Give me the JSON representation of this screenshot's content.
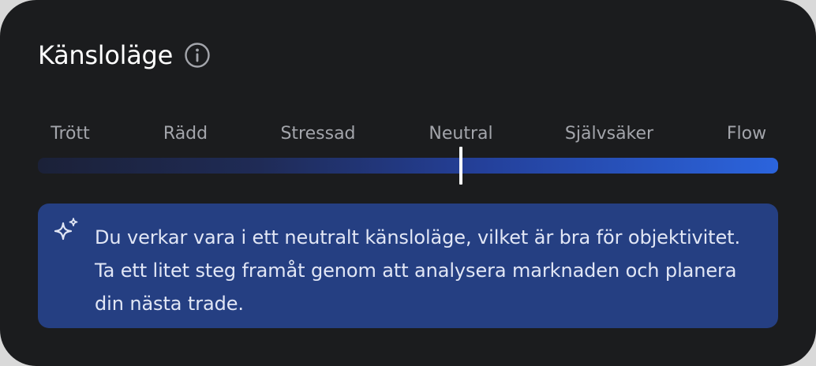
{
  "card": {
    "title": "Känsloläge",
    "info_icon": "info-circle-icon"
  },
  "mood_scale": {
    "labels": [
      "Trött",
      "Rädd",
      "Stressad",
      "Neutral",
      "Självsäker",
      "Flow"
    ],
    "selected": "Neutral",
    "selected_position_fraction": 0.571,
    "gradient_colors": [
      "#1b2138",
      "#2b64dd"
    ]
  },
  "insight": {
    "icon": "sparkle-icon",
    "text": "Du verkar vara i ett neutralt känsloläge, vilket är bra för objektivitet. Ta ett litet steg framåt genom att analysera marknaden och planera din nästa trade."
  },
  "colors": {
    "card_background": "#1b1c1e",
    "message_background": "#253f82",
    "accent": "#2b64dd"
  }
}
